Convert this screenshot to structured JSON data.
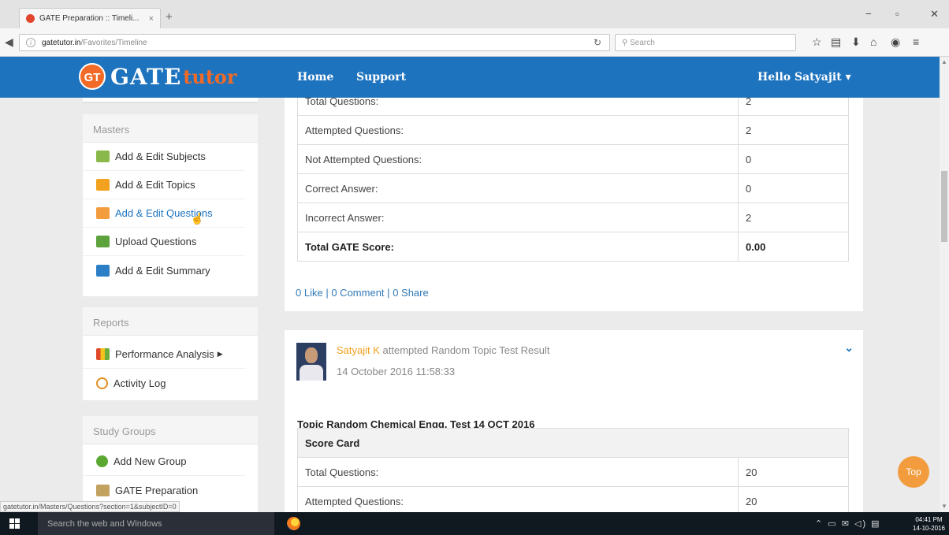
{
  "browser": {
    "tab_title": "GATE Preparation :: Timeli...",
    "tab_close": "×",
    "new_tab": "+",
    "url_host": "gatetutor.in",
    "url_path": "/Favorites/Timeline",
    "search_placeholder": "Search",
    "status_url": "gatetutor.in/Masters/Questions?section=1&subjectID=0"
  },
  "header": {
    "logo_badge": "GT",
    "logo_gate": "GATE",
    "logo_tutor": "tutor",
    "nav": [
      "Home",
      "Support"
    ],
    "greeting": "Hello Satyajit ▾"
  },
  "sidebar": {
    "masters": {
      "title": "Masters",
      "items": [
        {
          "label": "Add & Edit Subjects",
          "icon": "subjects-icon",
          "color": "#8bb84a"
        },
        {
          "label": "Add & Edit Topics",
          "icon": "pencil-icon",
          "color": "#f2a21e"
        },
        {
          "label": "Add & Edit Questions",
          "icon": "questions-icon",
          "color": "#f39c3d"
        },
        {
          "label": "Upload Questions",
          "icon": "upload-icon",
          "color": "#5da33c"
        },
        {
          "label": "Add & Edit Summary",
          "icon": "summary-icon",
          "color": "#2c7fc6"
        }
      ]
    },
    "reports": {
      "title": "Reports",
      "items": [
        {
          "label": "Performance Analysis",
          "icon": "bar-chart-icon",
          "color": "#6cae3b"
        },
        {
          "label": "Activity Log",
          "icon": "stopwatch-icon",
          "color": "#e38d1f"
        }
      ]
    },
    "study_groups": {
      "title": "Study Groups",
      "items": [
        {
          "label": "Add New Group",
          "icon": "add-group-icon",
          "color": "#5aa832"
        },
        {
          "label": "GATE Preparation",
          "icon": "group-icon",
          "color": "#c2a25f"
        }
      ]
    }
  },
  "post1": {
    "cut_label": "Total Questions:",
    "cut_value": "2",
    "rows": [
      {
        "label": "Attempted Questions:",
        "value": "2"
      },
      {
        "label": "Not Attempted Questions:",
        "value": "0"
      },
      {
        "label": "Correct Answer:",
        "value": "0"
      },
      {
        "label": "Incorrect Answer:",
        "value": "2"
      },
      {
        "label": "Total GATE Score:",
        "value": "0.00"
      }
    ],
    "likes": "0 Like",
    "comments": "0 Comment",
    "shares": "0 Share",
    "separator": "|"
  },
  "post2": {
    "user": "Satyajit K",
    "action": "attempted Random Topic Test Result",
    "date": "14 October 2016 11:58:33",
    "title": "Topic Random Chemical Engg. Test 14 OCT 2016",
    "score_card_label": "Score Card",
    "rows": [
      {
        "label": "Total Questions:",
        "value": "20"
      },
      {
        "label": "Attempted Questions:",
        "value": "20"
      }
    ]
  },
  "top_button": "Top",
  "taskbar": {
    "search_placeholder": "Search the web and Windows",
    "time": "04:41 PM",
    "date": "14-10-2016"
  }
}
